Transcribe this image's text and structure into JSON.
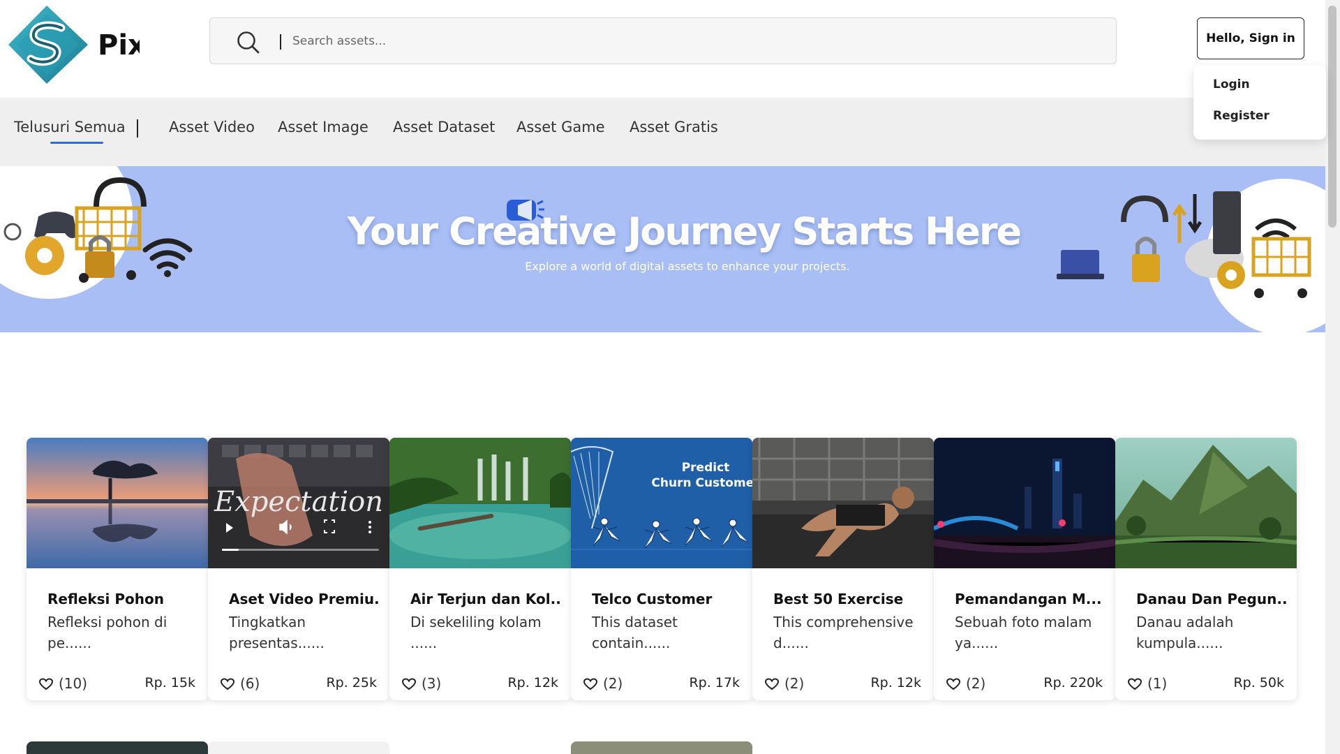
{
  "brand": {
    "name": "Pix",
    "logo_icon": "pixel-s-logo-icon"
  },
  "search": {
    "placeholder": "Search assets...",
    "icon": "search-icon"
  },
  "account": {
    "signin_label": "Hello, Sign in",
    "menu": [
      {
        "label": "Login"
      },
      {
        "label": "Register"
      }
    ]
  },
  "nav": {
    "items": [
      {
        "label": "Telusuri Semua",
        "active": true
      },
      {
        "label": "Asset Video"
      },
      {
        "label": "Asset Image"
      },
      {
        "label": "Asset Dataset"
      },
      {
        "label": "Asset Game"
      },
      {
        "label": "Asset Gratis"
      }
    ]
  },
  "banner": {
    "title": "Your Creative Journey Starts Here",
    "subtitle": "Explore a world of digital assets to enhance your projects."
  },
  "products": [
    {
      "title": "Refleksi Pohon",
      "desc": "Refleksi pohon di pe......",
      "likes": "(10)",
      "price": "Rp. 15k"
    },
    {
      "title": "Aset Video Premiu...",
      "desc": "Tingkatkan presentas......",
      "likes": "(6)",
      "price": "Rp. 25k",
      "overlay_text": "Expectation"
    },
    {
      "title": "Air Terjun dan Kol...",
      "desc": "Di sekeliling kolam ......",
      "likes": "(3)",
      "price": "Rp. 12k"
    },
    {
      "title": "Telco Customer",
      "desc": "This dataset contain......",
      "likes": "(2)",
      "price": "Rp. 17k",
      "overlay_text": "Predict\nChurn Customer"
    },
    {
      "title": "Best 50 Exercise",
      "desc": "This comprehensive d......",
      "likes": "(2)",
      "price": "Rp. 12k"
    },
    {
      "title": "Pemandangan M...",
      "desc": "Sebuah foto malam ya......",
      "likes": "(2)",
      "price": "Rp. 220k"
    },
    {
      "title": "Danau Dan Pegun...",
      "desc": "Danau adalah kumpula......",
      "likes": "(1)",
      "price": "Rp. 50k"
    }
  ],
  "colors": {
    "banner_bg": "#a8bef5",
    "nav_bg": "#efefef",
    "accent": "#2f6bd6"
  }
}
